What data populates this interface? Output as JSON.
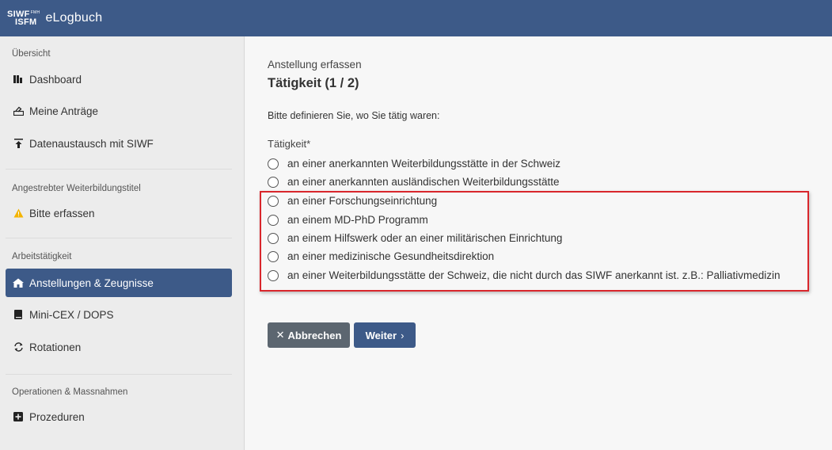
{
  "header": {
    "logo_line1": "SIWF",
    "logo_fmh": "FMH",
    "logo_line2": "ISFM",
    "app_title": "eLogbuch"
  },
  "sidebar": {
    "sections": [
      {
        "title": "Übersicht"
      },
      {
        "title": "Angestrebter Weiterbildungstitel"
      },
      {
        "title": "Arbeitstätigkeit"
      },
      {
        "title": "Operationen & Massnahmen"
      }
    ],
    "items": [
      {
        "label": "Dashboard",
        "icon": "dashboard-icon"
      },
      {
        "label": "Meine Anträge",
        "icon": "form-icon"
      },
      {
        "label": "Datenaustausch mit SIWF",
        "icon": "upload-icon"
      },
      {
        "label": "Bitte erfassen",
        "icon": "warning-icon"
      },
      {
        "label": "Anstellungen & Zeugnisse",
        "icon": "house-icon",
        "active": true
      },
      {
        "label": "Mini-CEX / DOPS",
        "icon": "book-icon"
      },
      {
        "label": "Rotationen",
        "icon": "rotate-icon"
      },
      {
        "label": "Prozeduren",
        "icon": "plus-square-icon"
      }
    ]
  },
  "main": {
    "subtitle": "Anstellung erfassen",
    "title": "Tätigkeit (1 / 2)",
    "intro": "Bitte definieren Sie, wo Sie tätig waren:",
    "field_label": "Tätigkeit*",
    "options": [
      "an einer anerkannten Weiterbildungsstätte in der Schweiz",
      "an einer anerkannten ausländischen Weiterbildungsstätte",
      "an einer Forschungseinrichtung",
      "an einem MD-PhD Programm",
      "an einem Hilfswerk oder an einer militärischen Einrichtung",
      "an einer medizinische Gesundheitsdirektion",
      "an einer Weiterbildungsstätte der Schweiz, die nicht durch das SIWF anerkannt ist. z.B.: Palliativmedizin"
    ],
    "cancel_label": "Abbrechen",
    "next_label": "Weiter"
  },
  "colors": {
    "primary": "#3d5a88",
    "cancel": "#5c6670",
    "highlight": "#d9262c",
    "warning": "#f4b400"
  }
}
